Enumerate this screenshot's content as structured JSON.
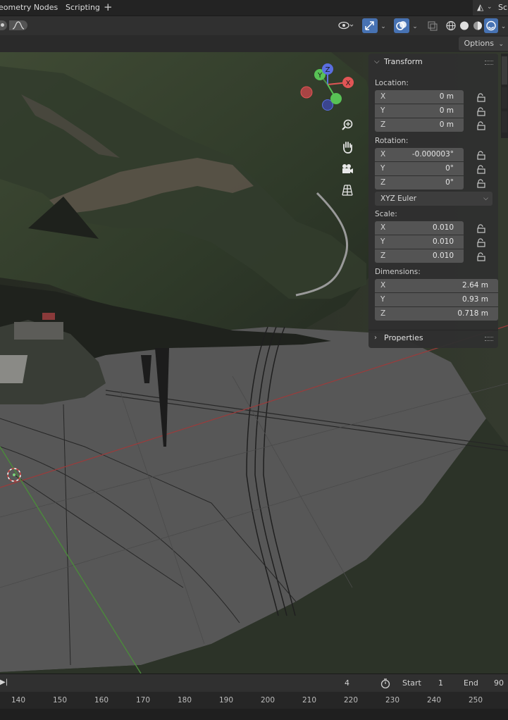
{
  "workspace_tabs": [
    "eometry Nodes",
    "Scripting"
  ],
  "workspace_add": "+",
  "workspace_right_label": "Sc",
  "header": {
    "options_label": "Options"
  },
  "viewport": {
    "gizmo": {
      "x": "X",
      "y": "Y",
      "z": "Z"
    },
    "tool_icons": [
      "zoom-icon",
      "hand-pan-icon",
      "camera-icon",
      "grid-perspective-icon"
    ]
  },
  "npanel": {
    "transform_title": "Transform",
    "location_label": "Location:",
    "location": [
      {
        "axis": "X",
        "value": "0 m"
      },
      {
        "axis": "Y",
        "value": "0 m"
      },
      {
        "axis": "Z",
        "value": "0 m"
      }
    ],
    "rotation_label": "Rotation:",
    "rotation": [
      {
        "axis": "X",
        "value": "-0.000003°"
      },
      {
        "axis": "Y",
        "value": "0°"
      },
      {
        "axis": "Z",
        "value": "0°"
      }
    ],
    "rotation_mode": "XYZ Euler",
    "scale_label": "Scale:",
    "scale": [
      {
        "axis": "X",
        "value": "0.010"
      },
      {
        "axis": "Y",
        "value": "0.010"
      },
      {
        "axis": "Z",
        "value": "0.010"
      }
    ],
    "dimensions_label": "Dimensions:",
    "dimensions": [
      {
        "axis": "X",
        "value": "2.64 m"
      },
      {
        "axis": "Y",
        "value": "0.93 m"
      },
      {
        "axis": "Z",
        "value": "0.718 m"
      }
    ],
    "properties_title": "Properties"
  },
  "timeline": {
    "current_frame": "4",
    "start_label": "Start",
    "start_value": "1",
    "end_label": "End",
    "end_value": "90",
    "ruler_ticks": [
      "140",
      "150",
      "160",
      "170",
      "180",
      "190",
      "200",
      "210",
      "220",
      "230",
      "240",
      "250"
    ]
  },
  "colors": {
    "accent_blue": "#4772b3",
    "axis_x_red": "#e05555",
    "axis_y_green": "#58c255",
    "axis_z_blue": "#5a6ee0",
    "panel_bg": "#303030",
    "field_bg": "#545454"
  }
}
